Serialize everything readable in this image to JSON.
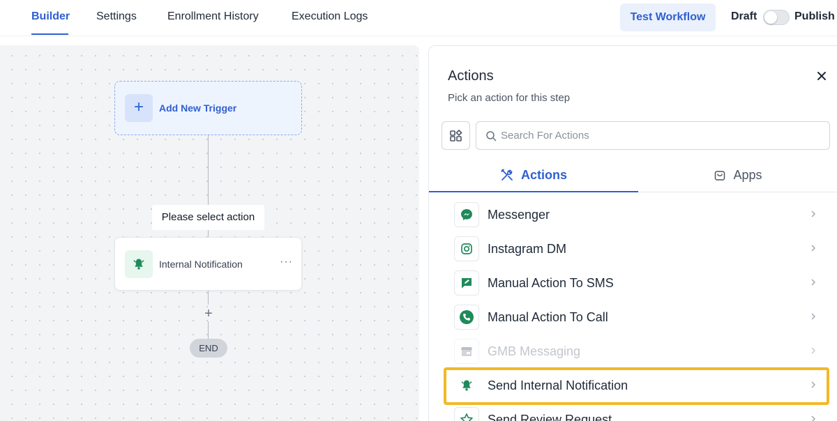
{
  "topbar": {
    "tabs": [
      {
        "label": "Builder"
      },
      {
        "label": "Settings"
      },
      {
        "label": "Enrollment History"
      },
      {
        "label": "Execution Logs"
      }
    ],
    "test_button": "Test Workflow",
    "draft_label": "Draft",
    "publish_label": "Publish"
  },
  "canvas": {
    "trigger_label": "Add New Trigger",
    "select_action_label": "Please select action",
    "action_card_label": "Internal Notification",
    "end_label": "END"
  },
  "panel": {
    "title": "Actions",
    "subtitle": "Pick an action for this step",
    "search_placeholder": "Search For Actions",
    "search_value": "",
    "tabs": {
      "actions": "Actions",
      "apps": "Apps"
    },
    "items": [
      {
        "label": "Messenger",
        "icon": "messenger-icon",
        "disabled": false
      },
      {
        "label": "Instagram DM",
        "icon": "instagram-icon",
        "disabled": false
      },
      {
        "label": "Manual Action To SMS",
        "icon": "manual-sms-icon",
        "disabled": false
      },
      {
        "label": "Manual Action To Call",
        "icon": "phone-icon",
        "disabled": false
      },
      {
        "label": "GMB Messaging",
        "icon": "gmb-store-icon",
        "disabled": true
      },
      {
        "label": "Send Internal Notification",
        "icon": "bell-icon",
        "disabled": false,
        "highlighted": true
      },
      {
        "label": "Send Review Request",
        "icon": "star-icon",
        "disabled": false
      }
    ]
  },
  "colors": {
    "accent": "#2f5fd0",
    "icon_green": "#1f8a5b",
    "highlight": "#f2b926"
  }
}
